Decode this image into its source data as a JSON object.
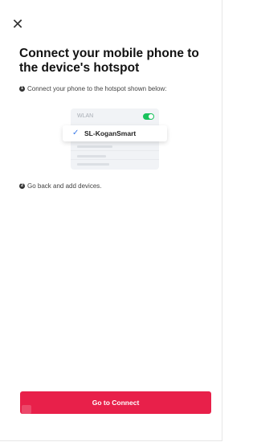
{
  "header": {
    "close_icon_glyph": "✕"
  },
  "title": "Connect your mobile phone to the device's hotspot",
  "steps": [
    {
      "num": "1",
      "text": "Connect your phone to the hotspot shown below:"
    },
    {
      "num": "2",
      "text": "Go back and add devices."
    }
  ],
  "illustration": {
    "wlan_label": "WLAN",
    "wlan_toggle_on": true,
    "hotspot_name": "SL-KoganSmart",
    "check_glyph": "✓"
  },
  "button": {
    "label": "Go to Connect"
  },
  "colors": {
    "accent": "#e8204a",
    "toggle_on": "#19c25c",
    "check": "#3d7be8"
  }
}
